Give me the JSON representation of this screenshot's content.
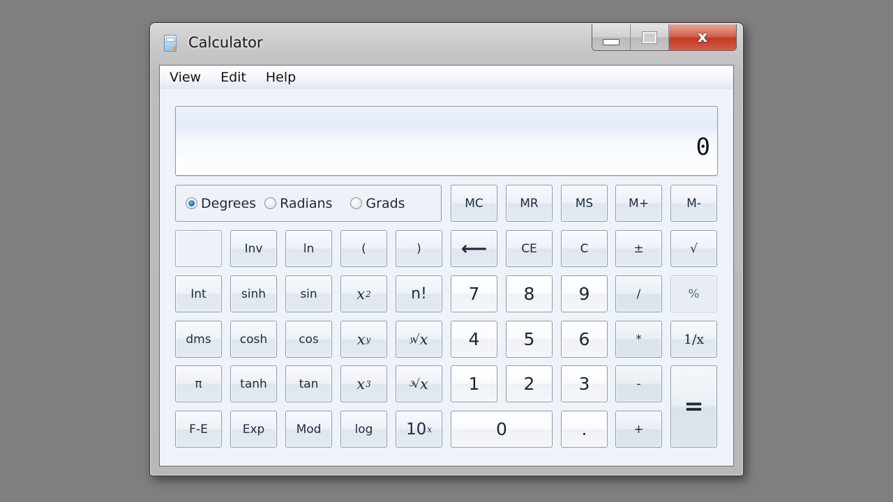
{
  "window": {
    "title": "Calculator",
    "controls": {
      "minimize": "minimize",
      "maximize": "maximize",
      "close": "x"
    }
  },
  "menu": [
    "View",
    "Edit",
    "Help"
  ],
  "display": {
    "value": "0"
  },
  "angle_units": {
    "options": [
      "Degrees",
      "Radians",
      "Grads"
    ],
    "selected": "Degrees"
  },
  "memory_buttons": [
    "MC",
    "MR",
    "MS",
    "M+",
    "M-"
  ],
  "buttons": {
    "row2": [
      "",
      "Inv",
      "ln",
      "(",
      ")",
      "⟵",
      "CE",
      "C",
      "±",
      "√"
    ],
    "row3": [
      "Int",
      "sinh",
      "sin",
      "x",
      "n!",
      "7",
      "8",
      "9",
      "/",
      "%"
    ],
    "row4": [
      "dms",
      "cosh",
      "cos",
      "x",
      "x",
      "4",
      "5",
      "6",
      "*",
      "1/x"
    ],
    "row5": [
      "π",
      "tanh",
      "tan",
      "x",
      "x",
      "1",
      "2",
      "3",
      "-",
      "="
    ],
    "row6": [
      "F-E",
      "Exp",
      "Mod",
      "log",
      "10",
      "0",
      ".",
      "+"
    ]
  },
  "superscripts": {
    "x2": "2",
    "xy": "y",
    "x3": "3",
    "yroot": "y",
    "cuberoot": "3",
    "tenx": "x",
    "root_symbol": "√"
  }
}
